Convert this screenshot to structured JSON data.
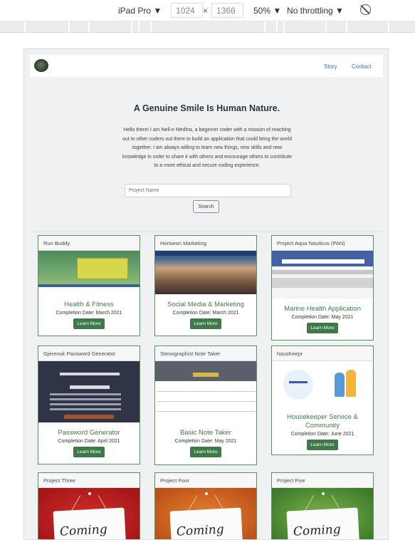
{
  "devtools": {
    "device": "iPad Pro",
    "width": "1024",
    "separator": "×",
    "height": "1366",
    "zoom": "50%",
    "throttle": "No throttling",
    "arrow": "▼"
  },
  "nav": {
    "links": [
      "Story",
      "Contact"
    ]
  },
  "hero": {
    "title": "A Genuine Smile Is Human Nature.",
    "text": "Hello there! I am Nell-e Medina, a beginner coder with a mission of reaching out to other coders out there to build an application that could bring the world together. I am always willing to learn new things, new skills and new knowledge in order to share it with others and encourage others to contribute to a more ethical and secure coding experience.",
    "search_placeholder": "Project Name",
    "search_button": "Search"
  },
  "projects": [
    {
      "header": "Run Buddy",
      "title": "Health & Fitness",
      "date": "Completion Date: March 2021",
      "button": "Learn More"
    },
    {
      "header": "Horiseon Marketing",
      "title": "Social Media & Marketing",
      "date": "Completion Date: March 2021",
      "button": "Learn More"
    },
    {
      "header": "Project Aqua Nauticus (PAN)",
      "title": "Marine Health Application",
      "date": "Completion Date: May 2021",
      "button": "Learn More"
    },
    {
      "header": "Gjerenuk Password Generator",
      "title": "Password Generator",
      "date": "Completion Date: April 2021",
      "button": "Learn More"
    },
    {
      "header": "Stenographist Note Taker",
      "title": "Basic Note Taker",
      "date": "Completion Date: May 2021",
      "button": "Learn More"
    },
    {
      "header": "hausKeepr",
      "title": "Housekeeper Service & Community",
      "date": "Completion Date: June 2021",
      "button": "Learn More"
    },
    {
      "header": "Project Three",
      "sign": "Coming"
    },
    {
      "header": "Project Four",
      "sign": "Coming"
    },
    {
      "header": "Project Five",
      "sign": "Coming"
    }
  ]
}
